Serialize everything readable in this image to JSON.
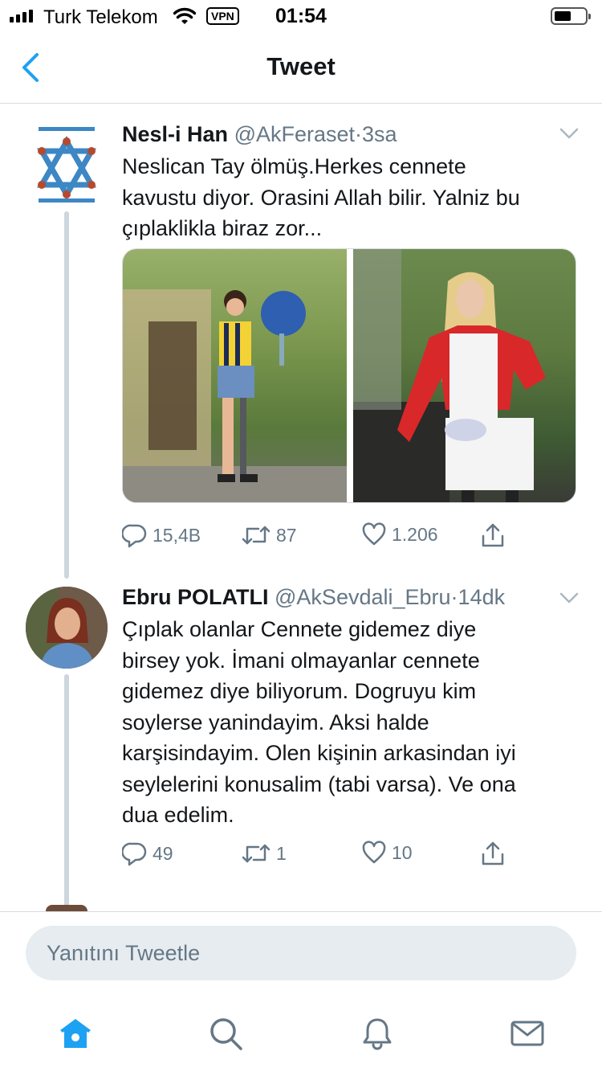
{
  "status_bar": {
    "carrier": "Turk Telekom",
    "vpn": "VPN",
    "time": "01:54"
  },
  "nav": {
    "title": "Tweet",
    "back_icon": "chevron-left-icon"
  },
  "tweets": [
    {
      "name": "Nesl-i Han",
      "handle": "@AkFeraset",
      "separator": "·",
      "time": "3sa",
      "text_lines": [
        "Neslican Tay ölmüş.Herkes cennete",
        "kavustu diyor. Orasini Allah bilir. Yalniz bu",
        "çıplaklikla biraz zor..."
      ],
      "replies": "15,4B",
      "retweets": "87",
      "likes": "1.206"
    },
    {
      "name": "Ebru POLATLI",
      "handle": "@AkSevdali_Ebru",
      "separator": "·",
      "time": "14dk",
      "text_lines": [
        "Çıplak olanlar Cennete gidemez diye",
        "birsey yok. İmani olmayanlar cennete",
        "gidemez diye biliyorum. Dogruyu kim",
        "soylerse yanindayim. Aksi halde",
        "karşisindayim. Olen kişinin arkasindan iyi",
        "seylelerini konusalim (tabi varsa). Ve ona",
        "dua edelim."
      ],
      "replies": "49",
      "retweets": "1",
      "likes": "10"
    }
  ],
  "reply": {
    "placeholder": "Yanıtını Tweetle"
  },
  "tabs": [
    "home-icon",
    "search-icon",
    "bell-icon",
    "mail-icon"
  ],
  "colors": {
    "accent": "#1da1f2",
    "muted": "#657786",
    "text": "#14171a",
    "divider": "#d6dbdf",
    "input_bg": "#e6ecf0"
  }
}
